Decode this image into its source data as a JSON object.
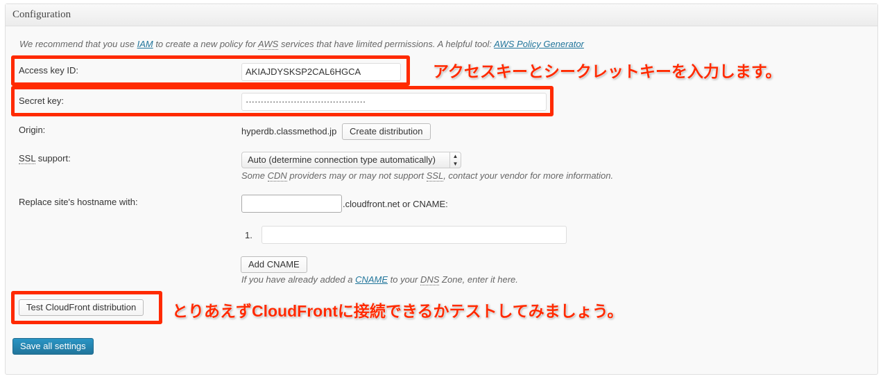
{
  "panel": {
    "title": "Configuration"
  },
  "intro": {
    "prefix": "We recommend that you use ",
    "iam": "IAM",
    "mid": " to create a new policy for ",
    "aws": "AWS",
    "suffix": " services that have limited permissions. A helpful tool: ",
    "policy_link": "AWS Policy Generator"
  },
  "access_key": {
    "label": "Access key ID:",
    "value": "AKIAJDYSKSP2CAL6HGCA"
  },
  "secret_key": {
    "label": "Secret key:",
    "value": "········································"
  },
  "origin": {
    "label": "Origin:",
    "value": "hyperdb.classmethod.jp",
    "button": "Create distribution"
  },
  "ssl": {
    "label_abbr": "SSL",
    "label_rest": " support:",
    "selected": "Auto (determine connection type automatically)",
    "note_pre": "Some ",
    "cdn": "CDN",
    "note_mid": " providers may or may not support ",
    "ssl": "SSL",
    "note_post": ", contact your vendor for more information."
  },
  "hostname": {
    "label": "Replace site's hostname with:",
    "value": "",
    "suffix": ".cloudfront.net or CNAME:",
    "cname_index": "1.",
    "cname_value": "",
    "add_button": "Add CNAME",
    "note_pre": "If you have already added a ",
    "cname_link": "CNAME",
    "note_mid": " to your ",
    "dns": "DNS",
    "note_post": " Zone, enter it here."
  },
  "test_button": "Test CloudFront distribution",
  "save_button": "Save all settings",
  "annotations": {
    "keys": "アクセスキーとシークレットキーを入力します。",
    "test": "とりあえずCloudFrontに接続できるかテストしてみましょう。"
  },
  "colors": {
    "highlight": "#ff2a00",
    "primary": "#21759b"
  }
}
